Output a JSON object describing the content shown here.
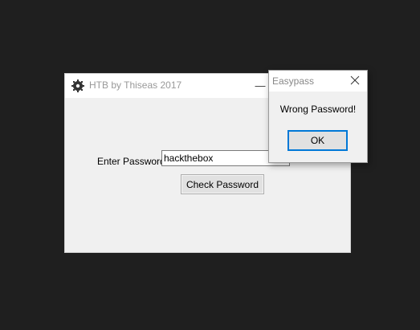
{
  "main_window": {
    "title": "HTB by Thiseas 2017",
    "minimize_glyph": "—",
    "icon": "gear-icon",
    "label": "Enter Password",
    "password_value": "hackthebox",
    "check_button_label": "Check Password"
  },
  "dialog": {
    "title": "Easypass",
    "message": "Wrong Password!",
    "ok_label": "OK",
    "close_icon": "close-icon",
    "accent_color": "#0078d7"
  },
  "colors": {
    "desktop_bg": "#1f1f1f",
    "window_bg": "#f0f0f0",
    "titlebar_bg": "#ffffff"
  }
}
